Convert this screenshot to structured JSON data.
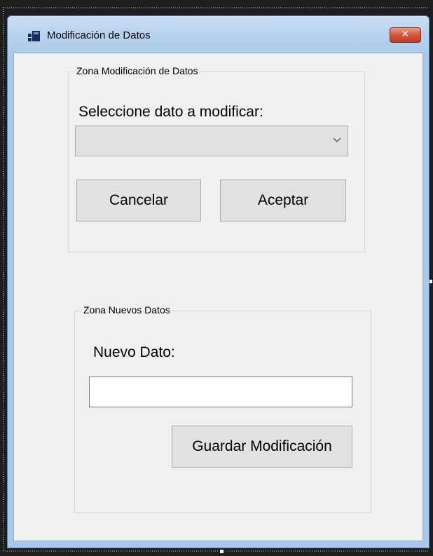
{
  "window": {
    "title": "Modificación de Datos",
    "close_glyph": "✕"
  },
  "group_modify": {
    "legend": "Zona Modificación de Datos",
    "prompt_label": "Seleccione dato a modificar:",
    "combo_value": "",
    "cancel_label": "Cancelar",
    "accept_label": "Aceptar"
  },
  "group_new": {
    "legend": "Zona Nuevos Datos",
    "new_label": "Nuevo Dato:",
    "new_value": "",
    "save_label": "Guardar Modificación"
  },
  "icons": {
    "app": "form-icon",
    "close": "close-icon",
    "dropdown": "chevron-down-icon"
  },
  "colors": {
    "titlebar": "#b9d3ee",
    "close_button": "#d5543c",
    "client_bg": "#f0f0f0",
    "button_bg": "#e1e1e1"
  }
}
